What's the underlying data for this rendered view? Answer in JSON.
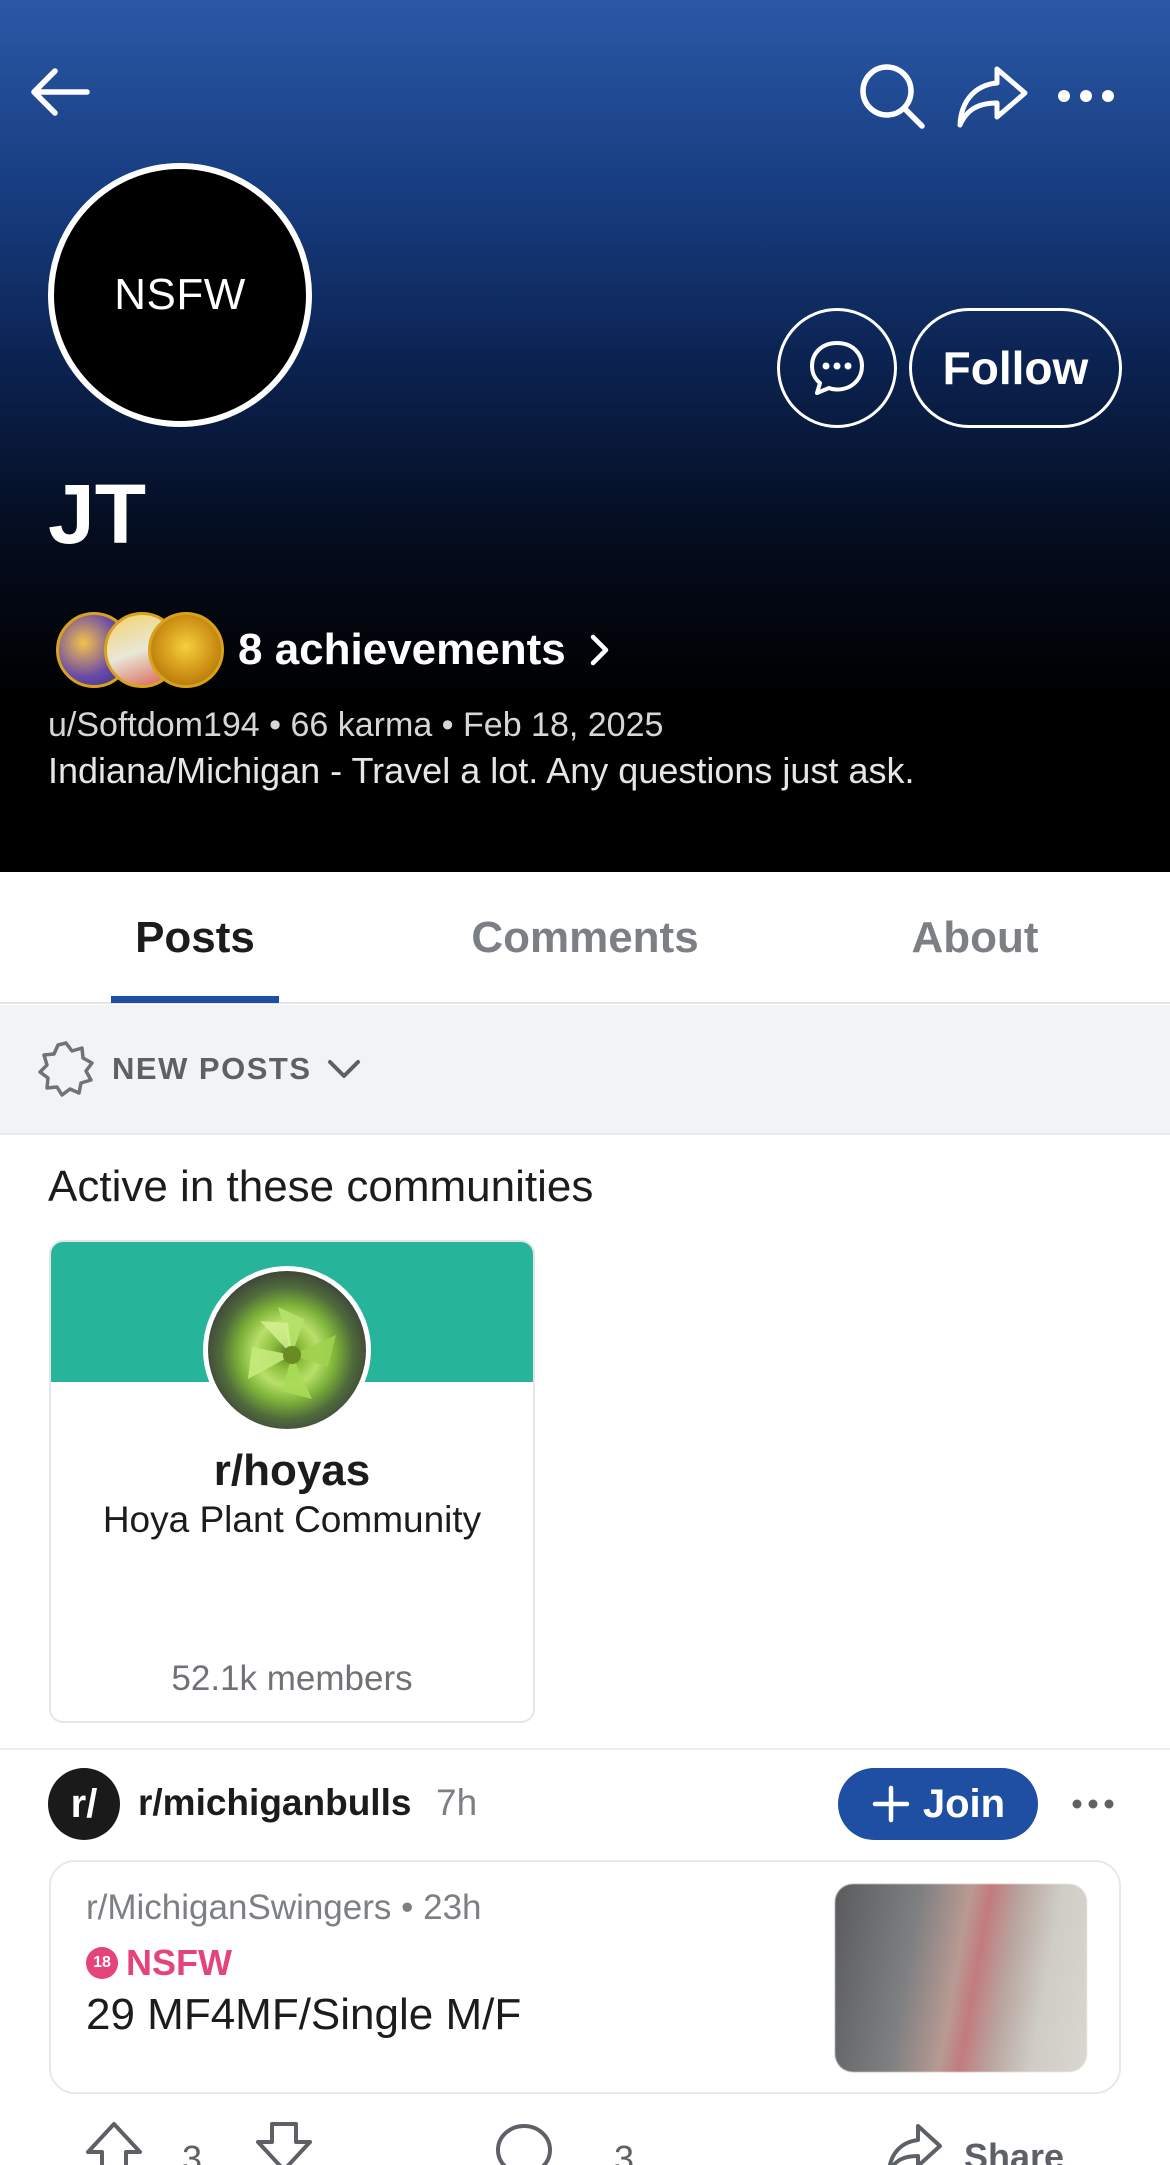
{
  "header": {
    "avatar_text": "NSFW",
    "display_name": "JT",
    "follow_label": "Follow",
    "achievements_label": "8 achievements",
    "meta_line": "u/Softdom194 • 66 karma • Feb 18, 2025",
    "bio": "Indiana/Michigan - Travel a lot. Any questions just ask."
  },
  "tabs": [
    {
      "label": "Posts",
      "active": true
    },
    {
      "label": "Comments",
      "active": false
    },
    {
      "label": "About",
      "active": false
    }
  ],
  "sort": {
    "label": "NEW POSTS"
  },
  "communities": {
    "title": "Active in these communities",
    "items": [
      {
        "name": "r/hoyas",
        "description": "Hoya Plant Community",
        "members": "52.1k members"
      }
    ]
  },
  "post": {
    "subreddit": "r/michiganbulls",
    "age": "7h",
    "join_label": "Join",
    "subreddit_icon_text": "r/",
    "crosspost": {
      "meta": "r/MichiganSwingers • 23h",
      "nsfw_badge": "18",
      "nsfw_label": "NSFW",
      "title": "29 MF4MF/Single M/F"
    },
    "score": "3",
    "comments": "3",
    "share_label": "Share"
  },
  "colors": {
    "accent": "#1f4fa3",
    "nsfw": "#e4447a",
    "community_banner": "#26b59a"
  }
}
